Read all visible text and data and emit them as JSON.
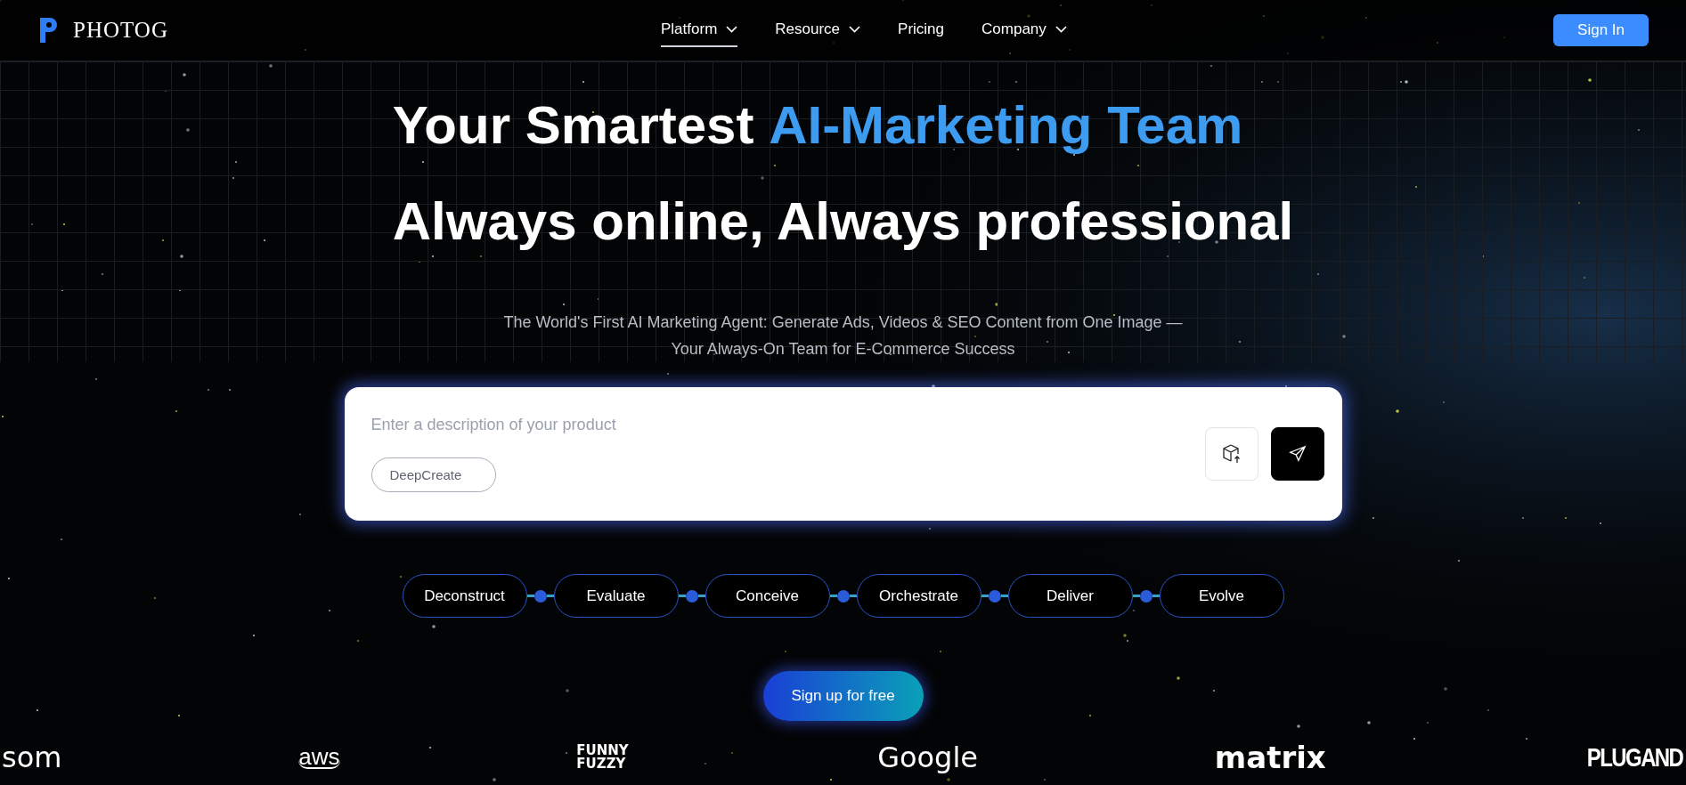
{
  "header": {
    "brand": "PHOTOG",
    "nav": [
      {
        "label": "Platform",
        "dropdown": true,
        "selected": true
      },
      {
        "label": "Resource",
        "dropdown": true,
        "selected": false
      },
      {
        "label": "Pricing",
        "dropdown": false,
        "selected": false
      },
      {
        "label": "Company",
        "dropdown": true,
        "selected": false
      }
    ],
    "sign_in": "Sign In"
  },
  "hero": {
    "headline": [
      "Your Smartest **AI-Marketing Team**",
      "Always online, Always professional"
    ],
    "subtitle": [
      "The World's First AI Marketing Agent: Generate Ads, Videos & SEO Content from One Image —",
      "Your Always-On Team for E-Commerce Success"
    ]
  },
  "prompt": {
    "placeholder": "Enter a description of your product",
    "mode_chip": "DeepCreate"
  },
  "steps": [
    "Deconstruct",
    "Evaluate",
    "Conceive",
    "Orchestrate",
    "Deliver",
    "Evolve"
  ],
  "cta": "Sign up for free",
  "logos": [
    {
      "text": "som",
      "kind": "rounded"
    },
    {
      "text": "aws",
      "kind": "aws"
    },
    {
      "text": "FUNNY FUZZY",
      "kind": "stacked"
    },
    {
      "text": "Google",
      "kind": "rounded"
    },
    {
      "text": "matrix",
      "kind": "heavy"
    },
    {
      "text": "PLUGAND",
      "kind": "condensed"
    }
  ]
}
